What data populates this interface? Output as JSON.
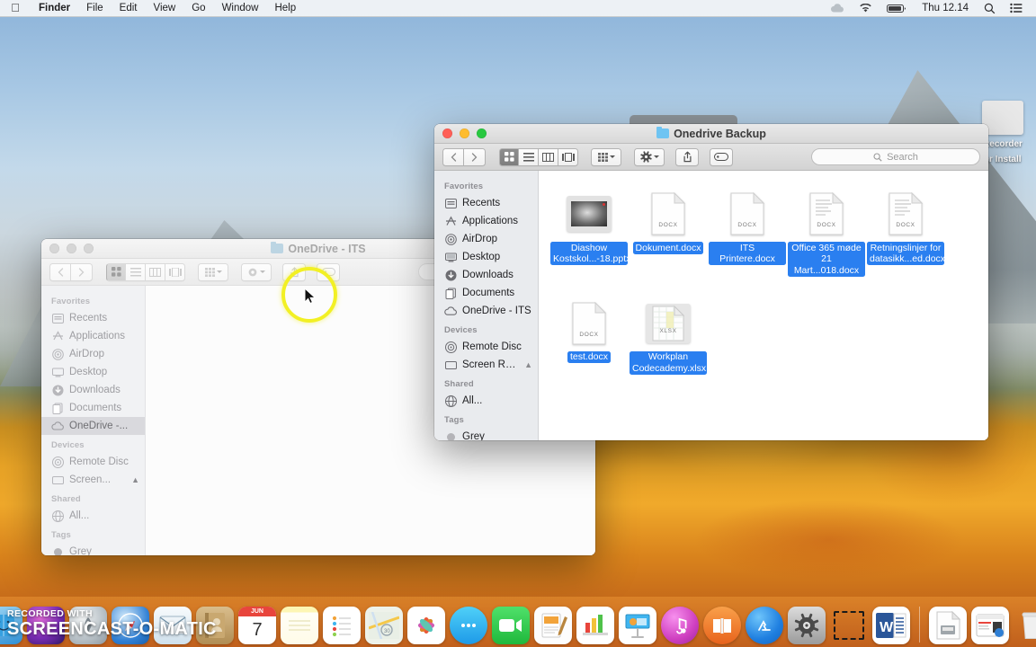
{
  "menubar": {
    "apple_icon": "apple-logo-icon",
    "items": [
      {
        "label": "Finder",
        "bold": true
      },
      {
        "label": "File",
        "bold": false
      },
      {
        "label": "Edit",
        "bold": false
      },
      {
        "label": "View",
        "bold": false
      },
      {
        "label": "Go",
        "bold": false
      },
      {
        "label": "Window",
        "bold": false
      },
      {
        "label": "Help",
        "bold": false
      }
    ],
    "status": {
      "cloud_icon": "cloud-icon",
      "wifi_icon": "wifi-icon",
      "battery_icon": "battery-icon",
      "clock": "Thu 12.14",
      "search_icon": "spotlight-search-icon",
      "control_center_icon": "control-center-icon"
    }
  },
  "front_window": {
    "title": "Onedrive Backup",
    "folder_icon": "blue-folder-icon",
    "traffic_lights": [
      "close-button",
      "minimize-button",
      "zoom-button"
    ],
    "toolbar": {
      "back_icon": "chevron-left-icon",
      "forward_icon": "chevron-right-icon",
      "view_modes": [
        {
          "name": "icon-view",
          "icon": "grid-icon",
          "active": true
        },
        {
          "name": "list-view",
          "icon": "list-icon",
          "active": false
        },
        {
          "name": "column-view",
          "icon": "columns-icon",
          "active": false
        },
        {
          "name": "gallery-view",
          "icon": "gallery-icon",
          "active": false
        }
      ],
      "arrange_icon": "arrange-grid-icon",
      "action_icon": "gear-icon",
      "share_icon": "share-icon",
      "tag_icon": "tag-icon",
      "search_placeholder": "Search",
      "search_value": ""
    },
    "sidebar": [
      {
        "header": "Favorites",
        "items": [
          {
            "label": "Recents",
            "icon": "clock-recents-icon",
            "selected": false
          },
          {
            "label": "Applications",
            "icon": "applications-icon",
            "selected": false
          },
          {
            "label": "AirDrop",
            "icon": "airdrop-icon",
            "selected": false
          },
          {
            "label": "Desktop",
            "icon": "desktop-icon",
            "selected": false
          },
          {
            "label": "Downloads",
            "icon": "downloads-icon",
            "selected": false
          },
          {
            "label": "Documents",
            "icon": "documents-icon",
            "selected": false
          },
          {
            "label": "OneDrive - ITS",
            "icon": "onedrive-cloud-icon",
            "selected": false
          }
        ]
      },
      {
        "header": "Devices",
        "items": [
          {
            "label": "Remote Disc",
            "icon": "remote-disc-icon",
            "selected": false
          },
          {
            "label": "Screen Re...",
            "icon": "external-drive-icon",
            "selected": false,
            "eject": true
          }
        ]
      },
      {
        "header": "Shared",
        "items": [
          {
            "label": "All...",
            "icon": "network-globe-icon",
            "selected": false
          }
        ]
      },
      {
        "header": "Tags",
        "items": [
          {
            "label": "Grey",
            "icon": "grey-tag-dot-icon",
            "selected": false
          }
        ]
      }
    ],
    "files": [
      {
        "name_lines": [
          "Diashow",
          "Kostskol...-18.pptx"
        ],
        "kind": "pptx",
        "icon": "powerpoint-preview-icon",
        "selected": true
      },
      {
        "name_lines": [
          "Dokument.docx"
        ],
        "kind": "DOCX",
        "icon": "docx-file-icon",
        "selected": true
      },
      {
        "name_lines": [
          "ITS Printere.docx"
        ],
        "kind": "DOCX",
        "icon": "docx-file-icon",
        "selected": true
      },
      {
        "name_lines": [
          "Office 365 møde",
          "21 Mart...018.docx"
        ],
        "kind": "DOCX",
        "icon": "docx-file-icon",
        "selected": true
      },
      {
        "name_lines": [
          "Retningslinjer for",
          "datasikk...ed.docx"
        ],
        "kind": "DOCX",
        "icon": "docx-file-icon",
        "selected": true
      },
      {
        "name_lines": [
          "test.docx"
        ],
        "kind": "DOCX",
        "icon": "docx-file-icon",
        "selected": true
      },
      {
        "name_lines": [
          "Workplan",
          "Codecademy.xlsx"
        ],
        "kind": "XLSX",
        "icon": "xlsx-file-icon",
        "selected": true
      }
    ]
  },
  "back_window": {
    "title": "OneDrive - ITS",
    "folder_icon": "onedrive-cloud-icon",
    "toolbar": {
      "search_placeholder": "",
      "search_value": ""
    },
    "sidebar": [
      {
        "header": "Favorites",
        "items": [
          {
            "label": "Recents",
            "icon": "clock-recents-icon",
            "selected": false
          },
          {
            "label": "Applications",
            "icon": "applications-icon",
            "selected": false
          },
          {
            "label": "AirDrop",
            "icon": "airdrop-icon",
            "selected": false
          },
          {
            "label": "Desktop",
            "icon": "desktop-icon",
            "selected": false
          },
          {
            "label": "Downloads",
            "icon": "downloads-icon",
            "selected": false
          },
          {
            "label": "Documents",
            "icon": "documents-icon",
            "selected": false
          },
          {
            "label": "OneDrive -...",
            "icon": "onedrive-cloud-icon",
            "selected": true
          }
        ]
      },
      {
        "header": "Devices",
        "items": [
          {
            "label": "Remote Disc",
            "icon": "remote-disc-icon",
            "selected": false
          },
          {
            "label": "Screen...",
            "icon": "external-drive-icon",
            "selected": false,
            "eject": true
          }
        ]
      },
      {
        "header": "Shared",
        "items": [
          {
            "label": "All...",
            "icon": "network-globe-icon",
            "selected": false
          }
        ]
      },
      {
        "header": "Tags",
        "items": [
          {
            "label": "Grey",
            "icon": "grey-tag-dot-icon",
            "selected": false
          }
        ]
      }
    ]
  },
  "desktop_item": {
    "line1": "Recorder",
    "line2": "er Install"
  },
  "dock": {
    "apps": [
      {
        "name": "finder",
        "label": "Finder",
        "color": "#2a9ae0",
        "glyph": "🗂",
        "running": true
      },
      {
        "name": "siri",
        "label": "Siri",
        "color": "#5b2f8f",
        "glyph": "◎",
        "running": false
      },
      {
        "name": "launchpad",
        "label": "Launchpad",
        "color": "#9aa3ab",
        "glyph": "🚀",
        "running": false
      },
      {
        "name": "safari",
        "label": "Safari",
        "color": "#2f7fd4",
        "glyph": "🧭",
        "running": true
      },
      {
        "name": "mail",
        "label": "Mail",
        "color": "#e9eef3",
        "glyph": "✉",
        "running": false
      },
      {
        "name": "contacts",
        "label": "Contacts",
        "color": "#c9a870",
        "glyph": "📒",
        "running": false
      },
      {
        "name": "calendar",
        "label": "Calendar",
        "color": "#ffffff",
        "glyph": "7",
        "running": false
      },
      {
        "name": "notes",
        "label": "Notes",
        "color": "#fdf3a8",
        "glyph": "☰",
        "running": false
      },
      {
        "name": "reminders",
        "label": "Reminders",
        "color": "#ffffff",
        "glyph": "•",
        "running": false
      },
      {
        "name": "maps",
        "label": "Maps",
        "color": "#dfe9df",
        "glyph": "➳",
        "running": false
      },
      {
        "name": "photos",
        "label": "Photos",
        "color": "#ffffff",
        "glyph": "✿",
        "running": false
      },
      {
        "name": "messages",
        "label": "Messages",
        "color": "#2ab7f5",
        "glyph": "💬",
        "running": false
      },
      {
        "name": "facetime",
        "label": "FaceTime",
        "color": "#2ecc4a",
        "glyph": "📹",
        "running": false
      },
      {
        "name": "pages",
        "label": "Pages",
        "color": "#f2a33a",
        "glyph": "✎",
        "running": false
      },
      {
        "name": "numbers",
        "label": "Numbers",
        "color": "#ffffff",
        "glyph": "📊",
        "running": false
      },
      {
        "name": "keynote",
        "label": "Keynote",
        "color": "#ffffff",
        "glyph": "📈",
        "running": false
      },
      {
        "name": "itunes",
        "label": "iTunes",
        "color": "#e45fd0",
        "glyph": "♫",
        "running": false
      },
      {
        "name": "ibooks",
        "label": "iBooks",
        "color": "#f07a22",
        "glyph": "📖",
        "running": false
      },
      {
        "name": "app-store",
        "label": "App Store",
        "color": "#1f8df5",
        "glyph": "A",
        "running": false
      },
      {
        "name": "system-preferences",
        "label": "System Preferences",
        "color": "#8d8d8d",
        "glyph": "⚙",
        "running": false
      },
      {
        "name": "screencast-o-matic",
        "label": "Screencast-O-Matic",
        "color": "#f29c28",
        "glyph": "",
        "running": true
      },
      {
        "name": "microsoft-word",
        "label": "Microsoft Word",
        "color": "#2a5699",
        "glyph": "W",
        "running": true
      }
    ],
    "minimized": [
      {
        "name": "document-stack",
        "label": "Documents",
        "glyph": "📄"
      },
      {
        "name": "browser-window",
        "label": "Window",
        "glyph": "🗔"
      },
      {
        "name": "trash",
        "label": "Trash",
        "glyph": "🗑"
      }
    ]
  },
  "watermark": {
    "line1": "RECORDED WITH",
    "line2": "SCREENCAST-O-MATIC"
  }
}
